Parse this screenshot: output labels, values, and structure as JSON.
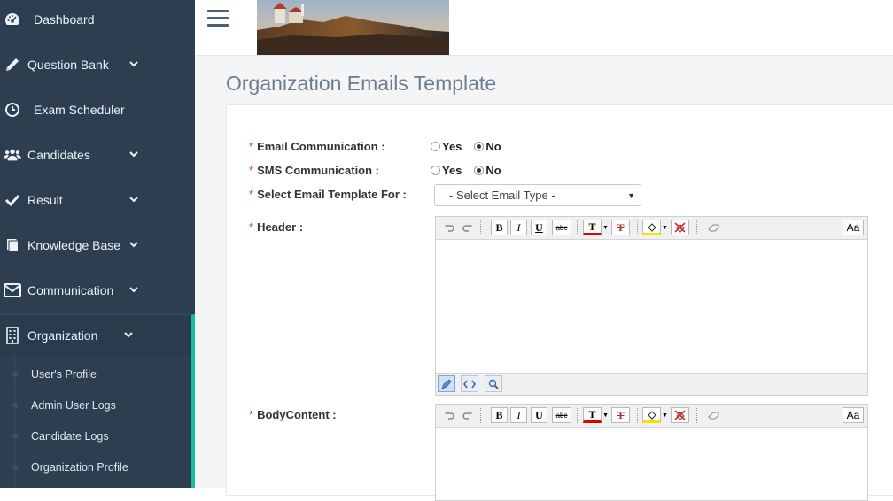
{
  "sidebar": {
    "items": [
      {
        "label": "Dashboard",
        "icon": "dashboard-icon"
      },
      {
        "label": "Question Bank",
        "icon": "pencil-icon"
      },
      {
        "label": "Exam Scheduler",
        "icon": "clock-icon"
      },
      {
        "label": "Candidates",
        "icon": "users-icon"
      },
      {
        "label": "Result",
        "icon": "check-icon"
      },
      {
        "label": "Knowledge Base",
        "icon": "book-icon"
      },
      {
        "label": "Communication",
        "icon": "envelope-icon"
      },
      {
        "label": "Organization",
        "icon": "building-icon"
      }
    ],
    "subitems": [
      {
        "label": "User's Profile"
      },
      {
        "label": "Admin User Logs"
      },
      {
        "label": "Candidate Logs"
      },
      {
        "label": "Organization Profile"
      }
    ],
    "accent": "#1abc9c",
    "background": "#2c3e50"
  },
  "main": {
    "title": "Organization Emails Template"
  },
  "form": {
    "email_comm": {
      "label": "Email Communication :",
      "yes": "Yes",
      "no": "No",
      "selected": "No"
    },
    "sms_comm": {
      "label": "SMS Communication :",
      "yes": "Yes",
      "no": "No",
      "selected": "No"
    },
    "template_for": {
      "label": "Select Email Template For :",
      "value": "- Select Email Type -"
    },
    "header": {
      "label": "Header :"
    },
    "body": {
      "label": "BodyContent :"
    },
    "required_mark": "*"
  },
  "editor": {
    "bold": "B",
    "italic": "I",
    "underline": "U",
    "strike": "abc",
    "font_color": "T",
    "clear_format": "T",
    "font_size": "Aa"
  }
}
